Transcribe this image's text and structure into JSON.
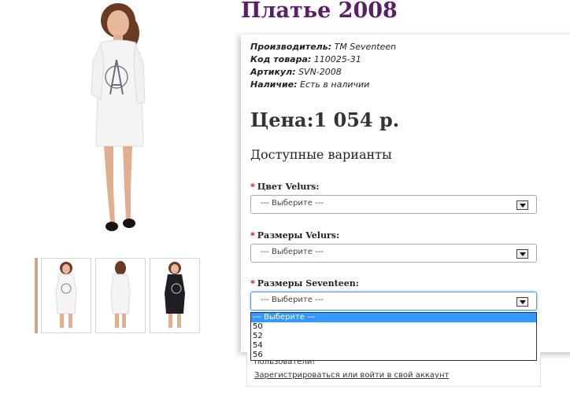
{
  "product": {
    "title": "Платье 2008"
  },
  "details": {
    "manufacturer_label": "Производитель:",
    "manufacturer_value": "ТМ Seventeen",
    "code_label": "Код товара:",
    "code_value": "110025-31",
    "sku_label": "Артикул:",
    "sku_value": "SVN-2008",
    "availability_label": "Наличие:",
    "availability_value": "Есть в наличии"
  },
  "price": {
    "text": "Цена:1 054 р."
  },
  "options": {
    "heading": "Доступные варианты",
    "required_mark": "*",
    "color_label": "Цвет Velurs:",
    "size_velurs_label": "Размеры Velurs:",
    "size_seventeen_label": "Размеры Seventeen:",
    "placeholder": "--- Выберите ---",
    "dropdown_options": [
      "--- Выберите ---",
      "50",
      "52",
      "54",
      "56"
    ]
  },
  "login": {
    "text_partial": "пользователи!",
    "link": "Зарегистрироваться или войти в свой аккаунт"
  },
  "colors": {
    "title": "#5a1f66",
    "required": "#e00000",
    "dropdown_highlight": "#3399ff",
    "focus_border": "#5b9dd9",
    "dress_white": "#f3f3f3",
    "dress_black": "#1e1e24"
  }
}
